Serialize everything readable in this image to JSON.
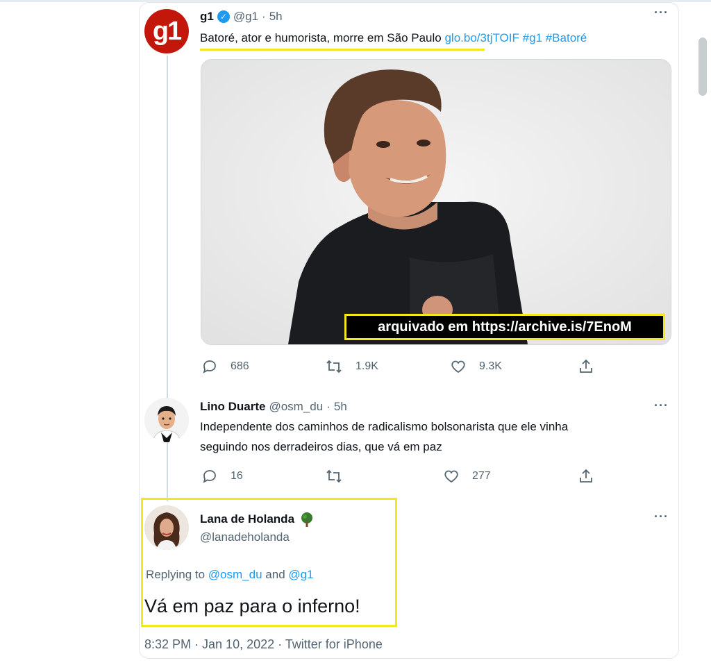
{
  "tweet1": {
    "avatar_text": "g1",
    "name": "g1",
    "handle": "@g1",
    "time": "5h",
    "text": "Batoré, ator e humorista, morre em São Paulo",
    "link": "glo.bo/3tjTOIF",
    "hashtag1": "#g1",
    "hashtag2": "#Batoré",
    "archive_text": "arquivado em https://archive.is/7EnoM",
    "replies": "686",
    "retweets": "1.9K",
    "likes": "9.3K"
  },
  "tweet2": {
    "name": "Lino Duarte",
    "handle": "@osm_du",
    "time": "5h",
    "text_line1": "Independente dos caminhos de radicalismo bolsonarista que ele vinha",
    "text_line2": "seguindo nos derradeiros dias, que vá em paz",
    "replies": "16",
    "likes": "277"
  },
  "tweet3": {
    "name": "Lana de Holanda",
    "handle": "@lanadeholanda",
    "replying_prefix": "Replying to",
    "replying_user1": "@osm_du",
    "replying_and": "and",
    "replying_user2": "@g1",
    "text": "Vá em paz para o inferno!",
    "footer": "8:32 PM · Jan 10, 2022 · Twitter for iPhone"
  },
  "separator": "·",
  "colors": {
    "accent": "#1d9bf0",
    "g1_red": "#c4170c",
    "highlight": "#f3e81f"
  }
}
